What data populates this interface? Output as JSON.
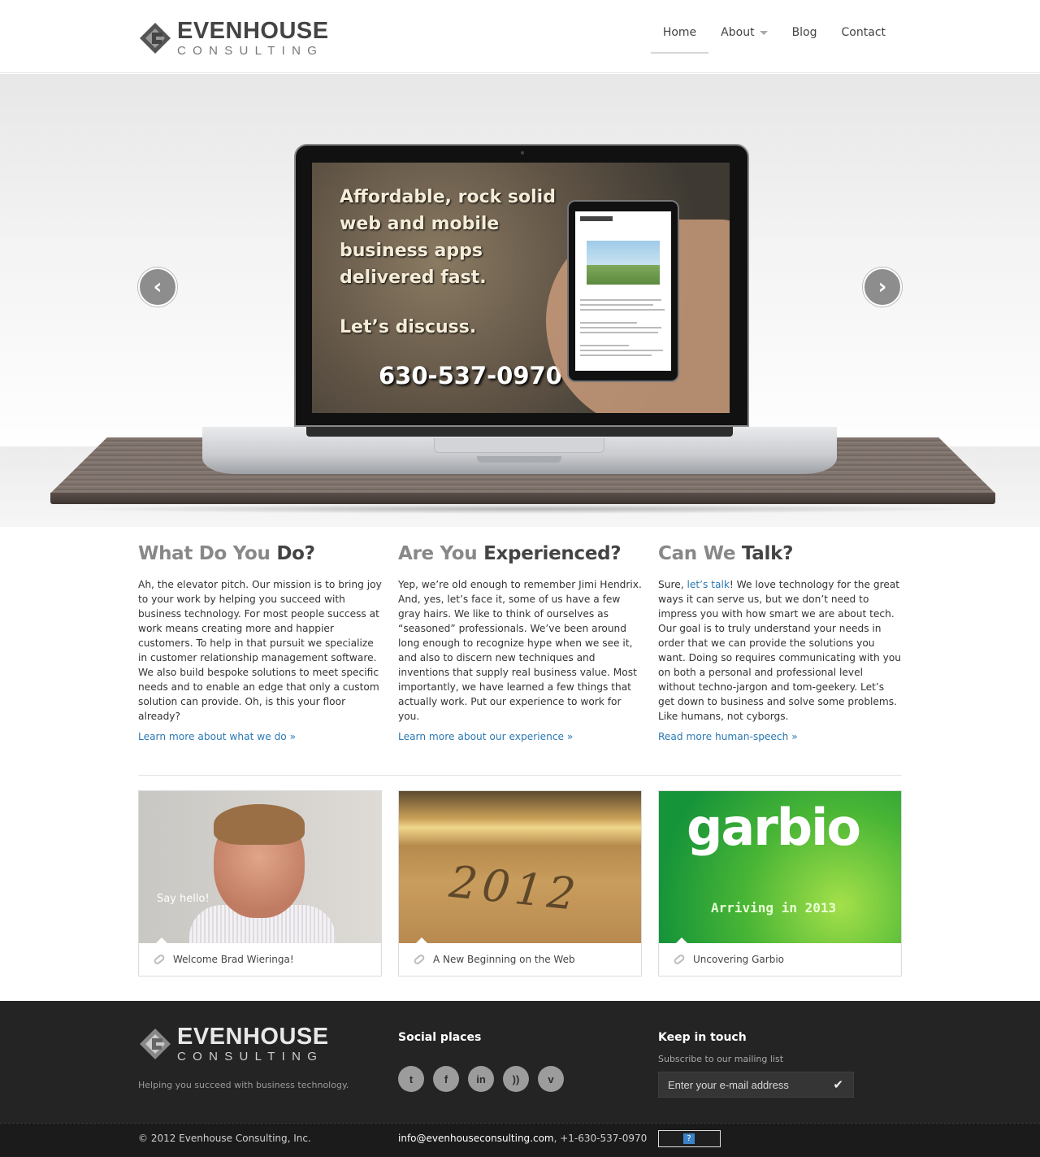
{
  "brand": {
    "name_line1": "EVENHOUSE",
    "name_line2": "CONSULTING"
  },
  "nav": {
    "home": "Home",
    "about": "About",
    "blog": "Blog",
    "contact": "Contact"
  },
  "hero": {
    "tagline": "Affordable, rock solid web and mobile business apps delivered fast.",
    "cta": "Let’s discuss.",
    "phone": "630-537-0970",
    "prev_icon": "chevron-left-icon",
    "next_icon": "chevron-right-icon",
    "prev_glyph": "‹",
    "next_glyph": "›"
  },
  "columns": [
    {
      "title_light": "What Do You",
      "title_strong": "Do?",
      "body": "Ah, the elevator pitch. Our mission is to bring joy to your work by helping you succeed with business technology. For most people success at work means creating more and happier customers. To help in that pursuit we specialize in customer relationship management software. We also build bespoke solutions to meet specific needs and to enable an edge that only a custom solution can provide. Oh, is this your floor already?",
      "more": "Learn more about what we do »"
    },
    {
      "title_light": "Are You",
      "title_strong": "Experienced?",
      "body": "Yep, we’re old enough to remember Jimi Hendrix. And, yes, let’s face it, some of us have a few gray hairs. We like to think of ourselves as “seasoned” professionals. We’ve been around long enough to recognize hype when we see it, and also to discern new techniques and inventions that supply real business value. Most importantly, we have learned a few things that actually work. Put our experience to work for you.",
      "more": "Learn more about our experience »"
    },
    {
      "title_light": "Can We",
      "title_strong": "Talk?",
      "body_prefix": "Sure, ",
      "body_link": "let’s talk",
      "body_rest": "! We love technology for the great ways it can serve us, but we don’t need to impress you with how smart we are about tech. Our goal is to truly understand your needs in order that we can provide the solutions you want. Doing so requires communicating with you on both a personal and professional level without techno-jargon and tom-geekery. Let’s get down to business and solve some problems. Like humans, not cyborgs.",
      "more": "Read more human-speech »"
    }
  ],
  "posts": [
    {
      "caption": "Welcome Brad Wieringa!",
      "overlay": "Say hello!"
    },
    {
      "caption": "A New Beginning on the Web",
      "overlay": "2012"
    },
    {
      "caption": "Uncovering Garbio",
      "overlay": "garbio",
      "overlay_sub": "Arriving in 2013"
    }
  ],
  "footer": {
    "tagline": "Helping you succeed with business technology.",
    "social_heading": "Social places",
    "social": [
      {
        "icon": "twitter-icon",
        "glyph": "t"
      },
      {
        "icon": "facebook-icon",
        "glyph": "f"
      },
      {
        "icon": "linkedin-icon",
        "glyph": "in"
      },
      {
        "icon": "rss-icon",
        "glyph": "))"
      },
      {
        "icon": "vimeo-icon",
        "glyph": "v"
      }
    ],
    "keep_heading": "Keep in touch",
    "subscribe_label": "Subscribe to our mailing list",
    "email_placeholder": "Enter your e-mail address",
    "submit_glyph": "✔",
    "copyright_prefix": "© 2012 ",
    "copyright_company": "Evenhouse Consulting, Inc.",
    "email": "info@evenhouseconsulting.com",
    "phone": ", +1-630-537-0970",
    "badge_glyph": "?"
  }
}
